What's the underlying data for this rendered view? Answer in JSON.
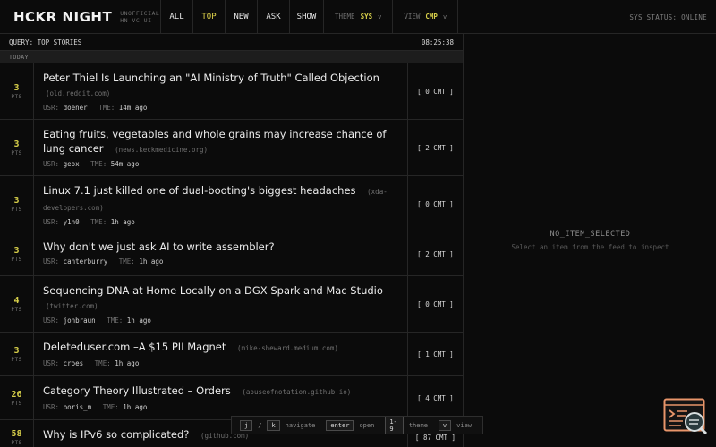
{
  "header": {
    "logo": "HCKR NIGHT",
    "logo_sub_1": "UNOFFICIAL",
    "logo_sub_2": "HN VC UI",
    "nav": [
      "ALL",
      "TOP",
      "NEW",
      "ASK",
      "SHOW"
    ],
    "active_nav": "TOP",
    "theme_label": "THEME",
    "theme_value": "SYS",
    "view_label": "VIEW",
    "view_value": "CMP",
    "caret": "v",
    "status": "SYS_STATUS: ONLINE"
  },
  "feed": {
    "query": "QUERY: TOP_STORIES",
    "clock": "08:25:38",
    "section": "TODAY",
    "pts_label": "PTS",
    "usr_label": "USR:",
    "tme_label": "TME:",
    "items": [
      {
        "pts": "3",
        "title": "Peter Thiel Is Launching an \"AI Ministry of Truth\" Called Objection",
        "domain": "(old.reddit.com)",
        "user": "doener",
        "time": "14m ago",
        "comments": "[ 0 CMT ]"
      },
      {
        "pts": "3",
        "title": "Eating fruits, vegetables and whole grains may increase chance of lung cancer",
        "domain": "(news.keckmedicine.org)",
        "user": "geox",
        "time": "54m ago",
        "comments": "[ 2 CMT ]"
      },
      {
        "pts": "3",
        "title": "Linux 7.1 just killed one of dual-booting's biggest headaches",
        "domain": "(xda-developers.com)",
        "user": "y1n0",
        "time": "1h ago",
        "comments": "[ 0 CMT ]"
      },
      {
        "pts": "3",
        "title": "Why don't we just ask AI to write assembler?",
        "domain": "",
        "user": "canterburry",
        "time": "1h ago",
        "comments": "[ 2 CMT ]"
      },
      {
        "pts": "4",
        "title": "Sequencing DNA at Home Locally on a DGX Spark and Mac Studio",
        "domain": "(twitter.com)",
        "user": "jonbraun",
        "time": "1h ago",
        "comments": "[ 0 CMT ]"
      },
      {
        "pts": "3",
        "title": "Deleteduser.com –A $15 PII Magnet",
        "domain": "(mike-sheward.medium.com)",
        "user": "croes",
        "time": "1h ago",
        "comments": "[ 1 CMT ]"
      },
      {
        "pts": "26",
        "title": "Category Theory Illustrated – Orders",
        "domain": "(abuseofnotation.github.io)",
        "user": "boris_m",
        "time": "1h ago",
        "comments": "[ 4 CMT ]"
      },
      {
        "pts": "58",
        "title": "Why is IPv6 so complicated?",
        "domain": "(github.com)",
        "user": "",
        "time": "",
        "comments": "[ 87 CMT ]"
      }
    ]
  },
  "detail": {
    "empty_title": "NO_ITEM_SELECTED",
    "empty_sub": "Select an item from the feed to inspect"
  },
  "hints": {
    "k1": "j",
    "sep": "/",
    "k2": "k",
    "l1": "navigate",
    "k3": "enter",
    "l2": "open",
    "k4": "1-9",
    "l3": "theme",
    "k5": "v",
    "l4": "view"
  },
  "colors": {
    "accent": "#d8d04a",
    "background": "#0b0b0b",
    "widget": "#e8956a"
  },
  "widget_icon": "inspector-icon"
}
